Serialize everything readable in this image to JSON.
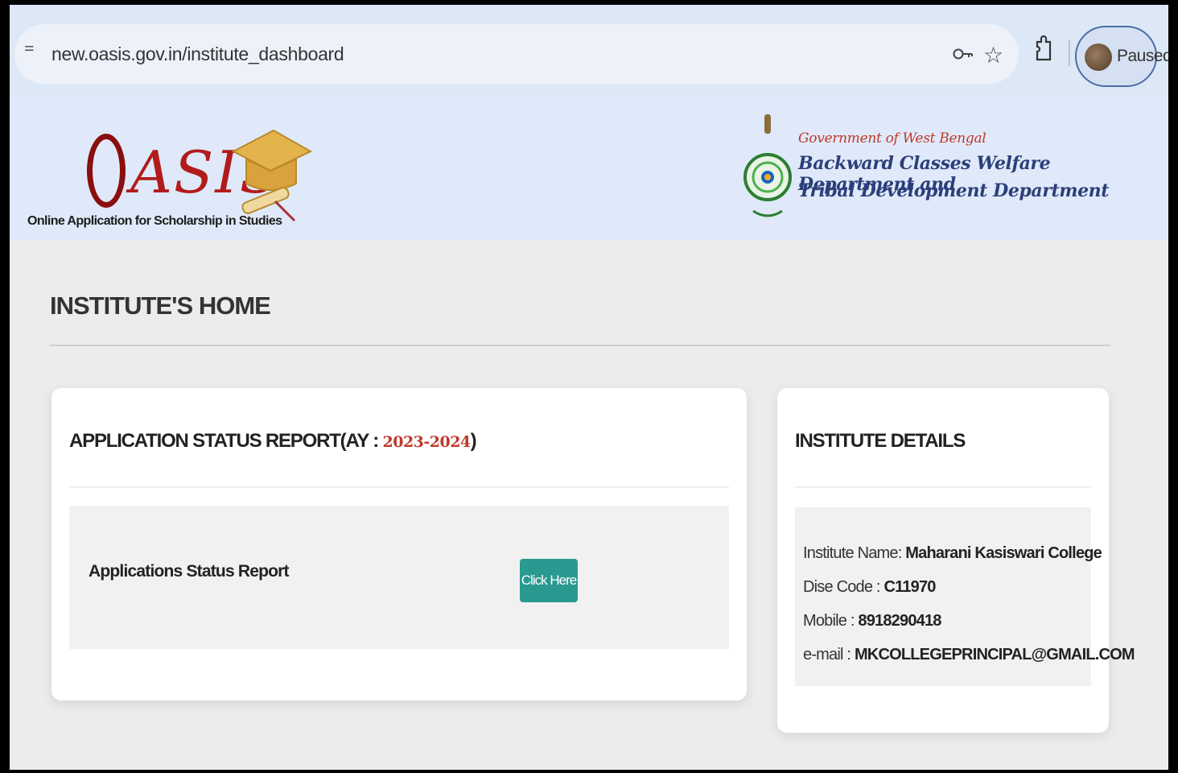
{
  "browser": {
    "url": "new.oasis.gov.in/institute_dashboard",
    "profile_label": "Paused",
    "icons": [
      "site-info-icon",
      "key-icon",
      "star-icon",
      "extension-icon"
    ]
  },
  "header": {
    "logo_wordmark": "ASIS",
    "logo_tagline": "Online Application for Scholarship in Studies",
    "gov_line1": "Government of West Bengal",
    "gov_line2": "Backward Classes Welfare Department and",
    "gov_line3": "Tribal Development Department"
  },
  "page": {
    "title": "INSTITUTE'S HOME"
  },
  "status_card": {
    "heading_prefix": "APPLICATION STATUS REPORT(AY : ",
    "year": "2023-2024",
    "heading_suffix": ")",
    "row_label": "Applications Status Report",
    "button_label": "Click Here",
    "accent_color": "#2a9990"
  },
  "details_card": {
    "heading": "INSTITUTE DETAILS",
    "rows": [
      {
        "label": "Institute Name: ",
        "value": "Maharani Kasiswari College"
      },
      {
        "label": "Dise Code : ",
        "value": "C11970"
      },
      {
        "label": "Mobile : ",
        "value": "8918290418"
      },
      {
        "label": "e-mail : ",
        "value": "MKCOLLEGEPRINCIPAL@GMAIL.COM"
      }
    ]
  }
}
